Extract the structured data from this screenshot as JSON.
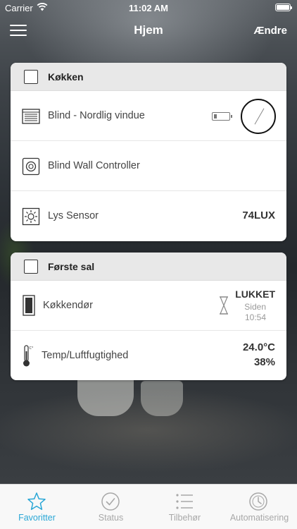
{
  "status_bar": {
    "carrier": "Carrier",
    "time": "11:02 AM"
  },
  "nav": {
    "title": "Hjem",
    "edit_label": "Ændre"
  },
  "rooms": [
    {
      "name": "Køkken",
      "devices": [
        {
          "name": "Blind - Nordlig vindue",
          "icon": "blind-icon"
        },
        {
          "name": "Blind Wall Controller",
          "icon": "wall-controller-icon"
        },
        {
          "name": "Lys Sensor",
          "icon": "light-sensor-icon",
          "value": "74LUX"
        }
      ]
    },
    {
      "name": "Første sal",
      "devices": [
        {
          "name": "Køkkendør",
          "icon": "door-icon",
          "state": "LUKKET",
          "since_label": "Siden",
          "since_time": "10:54"
        },
        {
          "name": "Temp/Luftfugtighed",
          "icon": "thermometer-icon",
          "temperature": "24.0°C",
          "humidity": "38%"
        }
      ]
    }
  ],
  "tabs": [
    {
      "label": "Favoritter",
      "icon": "star-icon",
      "active": true
    },
    {
      "label": "Status",
      "icon": "check-circle-icon",
      "active": false
    },
    {
      "label": "Tilbehør",
      "icon": "list-icon",
      "active": false
    },
    {
      "label": "Automatisering",
      "icon": "clock-icon",
      "active": false
    }
  ],
  "colors": {
    "accent": "#2aa7d6",
    "tab_inactive": "#a8a8a8",
    "header_bg": "#e8e8e8"
  }
}
